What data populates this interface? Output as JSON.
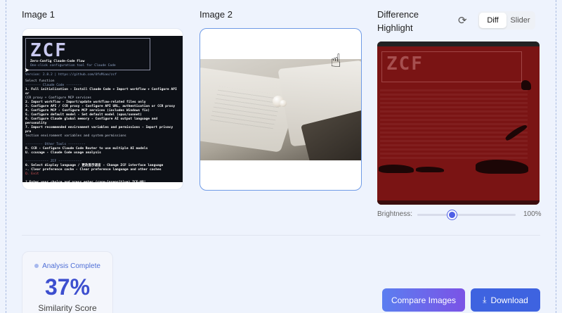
{
  "labels": {
    "image1": "Image 1",
    "image2": "Image 2",
    "diff": "Difference Highlight"
  },
  "view_toggle": {
    "options": [
      "Diff",
      "Slider"
    ],
    "selected": "Diff"
  },
  "terminal": {
    "logo": "ZCF",
    "title": "Zero-Config Claude-Code Flow",
    "subtitle": "One-click configuration tool for Claude Code",
    "version": "Version: 2.8.2  |  https://github.com/UfoMiao/zcf",
    "lines": [
      "Select function",
      "-------- Claude Code --------",
      " 1. Full initialization - Install Claude Code + Import workflow + Configure API or",
      "CCR proxy + Configure MCP services",
      " 2. Import workflow - Import/update workflow-related files only",
      " 3. Configure API / CCR proxy - Configure API URL, authentication or CCR proxy",
      " 4. Configure MCP - Configure MCP services (includes Windows fix)",
      " 5. Configure default model - Set default model (opus/sonnet)",
      " 6. Configure Claude global memory - Configure AI output language and personality",
      " 7. Import recommended environment variables and permissions - Import privacy pro",
      "tection environment variables and system permissions",
      "",
      "--------- Other Tools ---------",
      " R. CCR - Configure Claude Code Router to use multiple AI models",
      " U. ccusage - Claude Code usage analysis",
      "",
      "------------ ZCF ------------",
      " 0. Select display language / 更改显示语言 - Change ZCF interface language",
      " -. Clear preference cache - Clear preference language and other caches",
      " Q. Exit",
      "",
      "? Enter your choice and press enter (case-insensitive) ZCF-NB!"
    ]
  },
  "brightness": {
    "label": "Brightness:",
    "value_text": "100%",
    "level": 0.35
  },
  "result": {
    "status": "Analysis Complete",
    "score": "37%",
    "score_label": "Similarity Score"
  },
  "buttons": {
    "compare": "Compare Images",
    "download": "Download"
  },
  "colors": {
    "accent": "#3e63e0",
    "score": "#3d4fcf",
    "diff_bg": "#7a1414"
  }
}
